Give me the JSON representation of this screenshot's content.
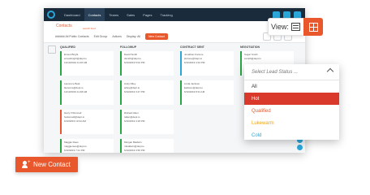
{
  "nav": {
    "items": [
      "Dashboard",
      "Contacts",
      "Teams",
      "Sales",
      "Pages",
      "Tracking"
    ],
    "active_index": 1
  },
  "header": {
    "title": "Contacts",
    "subtitle": "search food",
    "filter_label": "######  All Public Contacts",
    "toolbar": [
      "Edit Group",
      "Actions",
      "Display: All"
    ],
    "new_button": "New Contact"
  },
  "columns": [
    {
      "title": "QUALIFIED",
      "cards": [
        [
          "Ernest Bright",
          "ernestbright@dept.io",
          "12/10/2019 11:46 AM"
        ],
        [
          "Laurence Beal",
          "laurence@dept.io",
          "12/10/2019 11:48 AM"
        ],
        [
          "Harry O'Donnell",
          "hodonnell@dept.io",
          "6/10/2019 10:34 AM"
        ],
        [
          "Maggie Rees",
          "maggierees@dept.io",
          "6/10/2019 7:21 PM"
        ]
      ]
    },
    {
      "title": "FOLLOWUP",
      "cards": [
        [
          "David Smith",
          "dsmith@dept.io",
          "6/10/2019 5:02 PM"
        ],
        [
          "Andy Riley",
          "ariley@dept.io",
          "6/10/2019 3:47 PM"
        ],
        [
          "Richard Allen",
          "rallen@dept.io",
          "6/10/2019 4:18 PM"
        ],
        [
          "Morgan Baldwin",
          "mbaldwin@dept.io",
          "6/10/2019 3:56 PM"
        ]
      ]
    },
    {
      "title": "CONTRACT SENT",
      "cards": [
        [
          "Jonathan Fortune",
          "jfortune@dept.io",
          "6/10/2019 4:34 PM"
        ],
        [
          "Linda Jackson",
          "ljackson@dept.io",
          "6/10/2019 8:31 AM"
        ],
        [],
        []
      ]
    },
    {
      "title": "NEGOTIATION",
      "cards": [
        [
          "Sugar Smith",
          "ssmith@dept.io",
          ""
        ]
      ]
    }
  ],
  "view": {
    "label": "View:",
    "icons": [
      "list-icon",
      "grid-icon"
    ]
  },
  "status_dropdown": {
    "placeholder": "Select Lead Status ...",
    "options": [
      {
        "label": "All",
        "color": "#333333"
      },
      {
        "label": "Hot",
        "color": "#ffffff",
        "selected": true
      },
      {
        "label": "Qualified",
        "color": "#e8582c"
      },
      {
        "label": "Lukewarm",
        "color": "#f0a500"
      },
      {
        "label": "Cold",
        "color": "#2aa6d8"
      }
    ]
  },
  "new_contact_button": "New Contact",
  "colors": {
    "accent": "#e8582c",
    "nav": "#1a2b3c",
    "info": "#2aa6d8",
    "hot": "#d9392b"
  }
}
